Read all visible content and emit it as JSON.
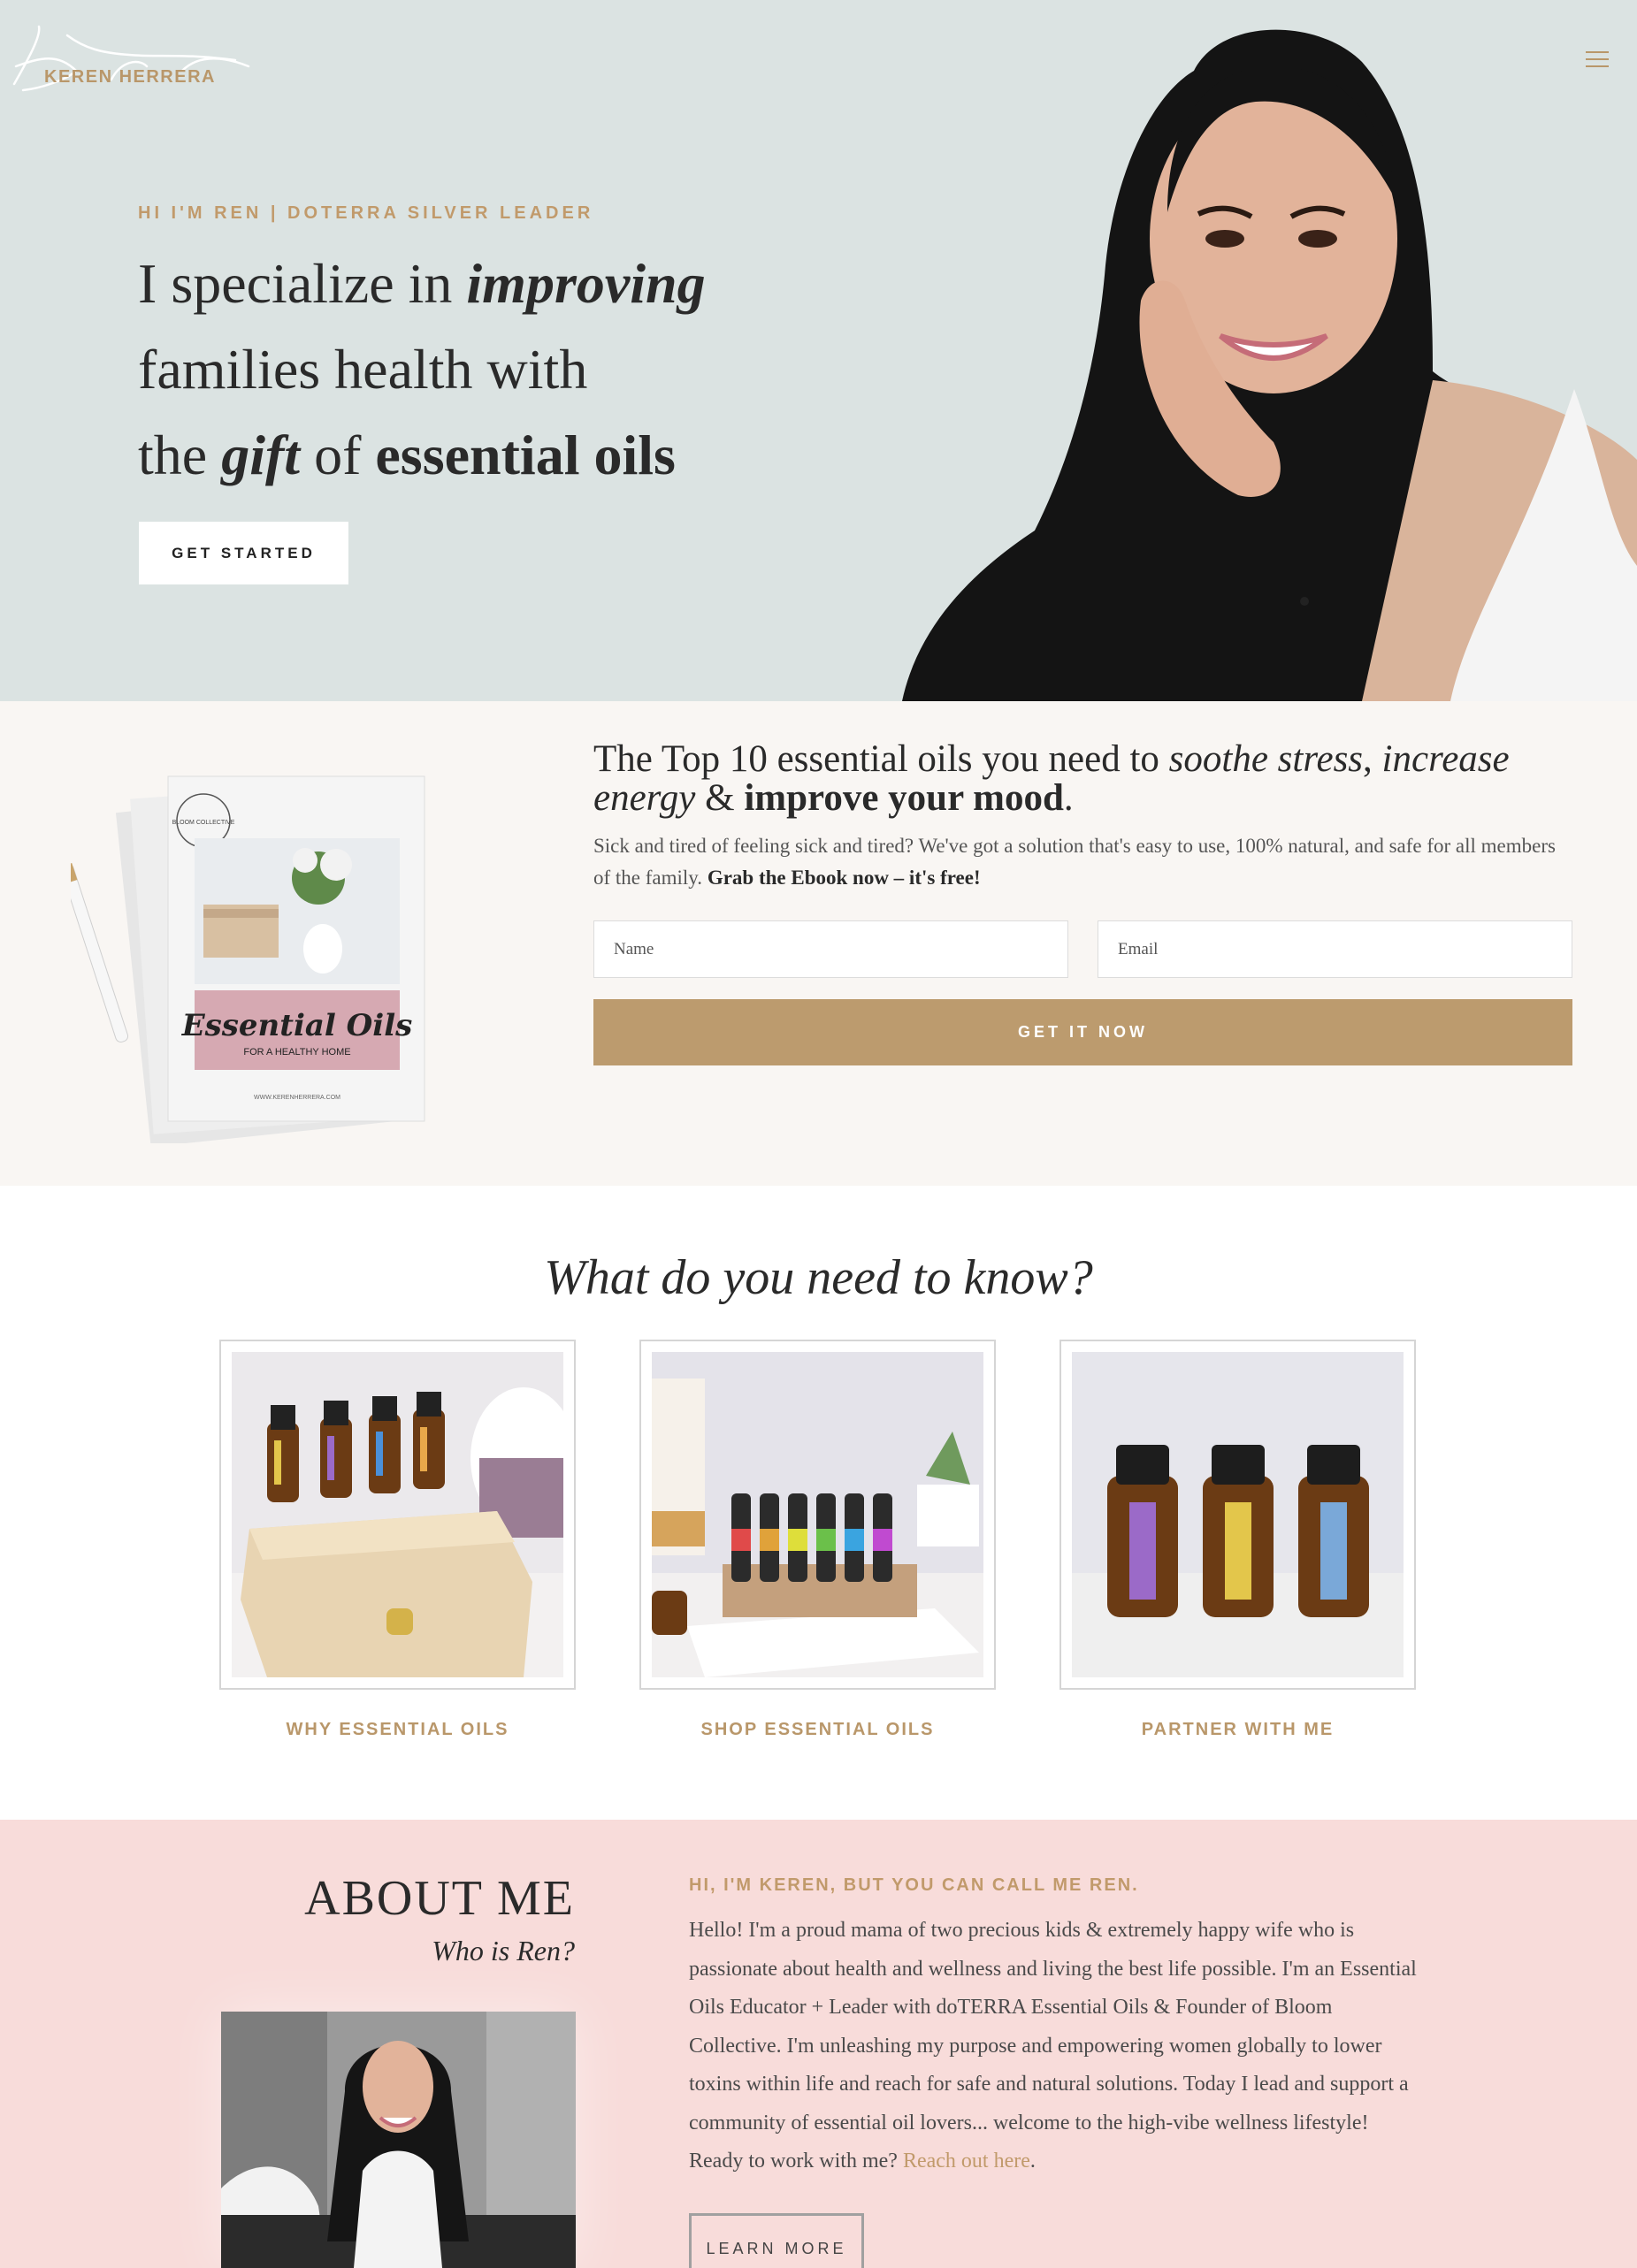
{
  "header": {
    "logo_text": "KEREN HERRERA",
    "menu_icon": "hamburger-menu-icon"
  },
  "hero": {
    "eyebrow": "HI I'M REN | DOTERRA SILVER LEADER",
    "heading_parts": {
      "t1": "I specialize in ",
      "t2": "improving",
      "t3": "families health with",
      "t4": "the ",
      "t5": "gift",
      "t6": " of ",
      "t7": "essential oils"
    },
    "cta_label": "GET STARTED"
  },
  "ebook": {
    "title_parts": {
      "t1": "The Top 10 essential oils you need to ",
      "t2": "soothe stress",
      "t3": ", ",
      "t4": "increase energy",
      "t5": " & ",
      "t6": "improve your mood",
      "t7": "."
    },
    "description": "Sick and tired of feeling sick and tired? We've got a solution that's easy to use, 100% natural, and safe for all members of the family. ",
    "description_bold": "Grab the Ebook now – it's free!",
    "cover_badge": "BLOOM COLLECTIVE",
    "cover_title": "Essential Oils",
    "cover_subtitle": "FOR A HEALTHY HOME",
    "cover_url": "WWW.KERENHERRERA.COM",
    "name_placeholder": "Name",
    "email_placeholder": "Email",
    "submit_label": "GET IT NOW"
  },
  "know": {
    "title": "What do you need to know?",
    "cards": [
      {
        "label": "WHY ESSENTIAL OILS"
      },
      {
        "label": "SHOP ESSENTIAL OILS"
      },
      {
        "label": "PARTNER WITH ME"
      }
    ]
  },
  "about": {
    "title": "ABOUT ME",
    "subtitle": "Who is Ren?",
    "eyebrow": "HI, I'M KEREN, BUT YOU CAN CALL ME REN.",
    "body": "Hello! I'm a proud mama of two precious kids & extremely happy wife who is passionate about health and wellness and living the best life possible. I'm an Essential Oils Educator + Leader with doTERRA Essential Oils & Founder of Bloom Collective. I'm unleashing my purpose and empowering women globally to lower toxins within life and reach for safe and natural solutions. Today I lead and support a community of essential oil lovers... welcome to the high-vibe wellness lifestyle! Ready to work with me? ",
    "link_text": "Reach out here",
    "body_end": ".",
    "button_label": "LEARN MORE"
  },
  "colors": {
    "hero_bg": "#dbe3e2",
    "ebook_bg": "#f9f6f3",
    "about_bg": "#f8dcda",
    "accent_gold": "#bc9b6e"
  }
}
